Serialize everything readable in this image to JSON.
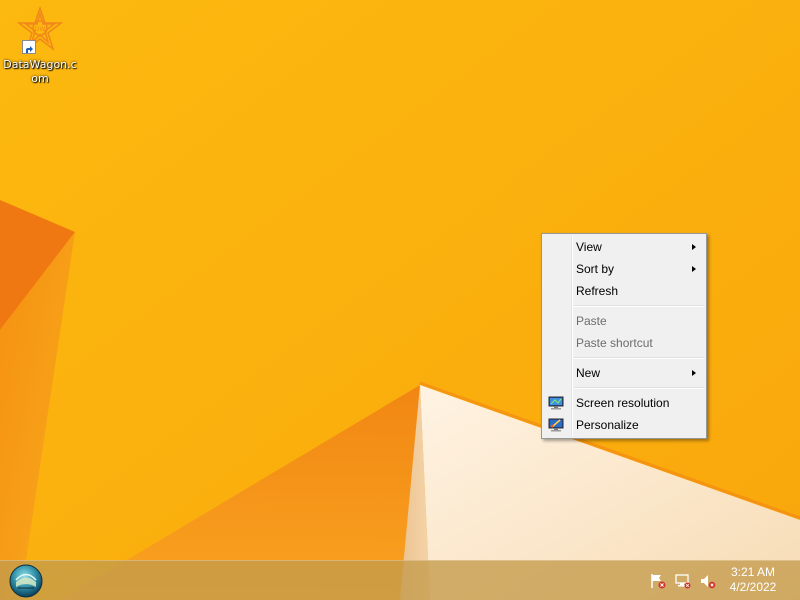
{
  "desktop": {
    "icons": [
      {
        "label": "DataWagon.com",
        "icon": "datawagon-logo-icon"
      }
    ]
  },
  "context_menu": {
    "items": [
      {
        "label": "View",
        "submenu": true,
        "enabled": true
      },
      {
        "label": "Sort by",
        "submenu": true,
        "enabled": true
      },
      {
        "label": "Refresh",
        "submenu": false,
        "enabled": true
      },
      {
        "label": "Paste",
        "submenu": false,
        "enabled": false
      },
      {
        "label": "Paste shortcut",
        "submenu": false,
        "enabled": false
      },
      {
        "label": "New",
        "submenu": true,
        "enabled": true
      },
      {
        "label": "Screen resolution",
        "submenu": false,
        "enabled": true,
        "icon": "monitor-resolution-icon"
      },
      {
        "label": "Personalize",
        "submenu": false,
        "enabled": true,
        "icon": "monitor-personalize-icon"
      }
    ]
  },
  "taskbar": {
    "start_icon": "start-orb-icon",
    "tray_icons": [
      "action-center-flag-icon",
      "network-icon",
      "volume-muted-icon"
    ],
    "clock": {
      "time": "3:21 AM",
      "date": "4/2/2022"
    }
  },
  "colors": {
    "wallpaper_base": "#fbb40e",
    "wallpaper_dark": "#f07d0a",
    "wallpaper_light": "#fde7c4",
    "menu_background": "#f0f0f0"
  }
}
